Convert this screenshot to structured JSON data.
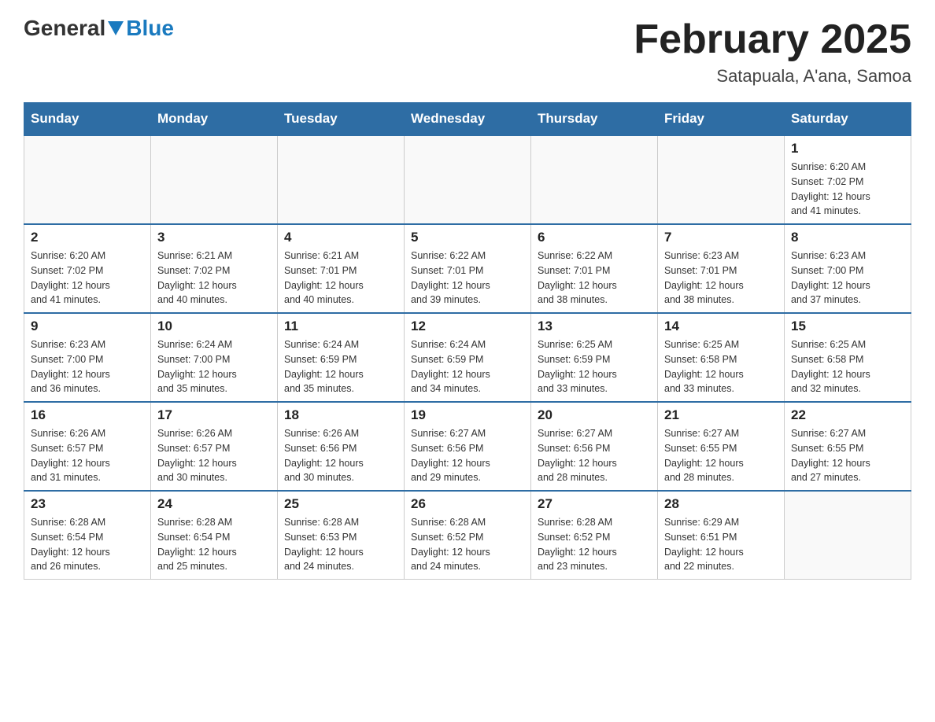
{
  "header": {
    "logo_general": "General",
    "logo_blue": "Blue",
    "month_title": "February 2025",
    "location": "Satapuala, A'ana, Samoa"
  },
  "weekdays": [
    "Sunday",
    "Monday",
    "Tuesday",
    "Wednesday",
    "Thursday",
    "Friday",
    "Saturday"
  ],
  "weeks": [
    [
      {
        "day": "",
        "info": ""
      },
      {
        "day": "",
        "info": ""
      },
      {
        "day": "",
        "info": ""
      },
      {
        "day": "",
        "info": ""
      },
      {
        "day": "",
        "info": ""
      },
      {
        "day": "",
        "info": ""
      },
      {
        "day": "1",
        "info": "Sunrise: 6:20 AM\nSunset: 7:02 PM\nDaylight: 12 hours\nand 41 minutes."
      }
    ],
    [
      {
        "day": "2",
        "info": "Sunrise: 6:20 AM\nSunset: 7:02 PM\nDaylight: 12 hours\nand 41 minutes."
      },
      {
        "day": "3",
        "info": "Sunrise: 6:21 AM\nSunset: 7:02 PM\nDaylight: 12 hours\nand 40 minutes."
      },
      {
        "day": "4",
        "info": "Sunrise: 6:21 AM\nSunset: 7:01 PM\nDaylight: 12 hours\nand 40 minutes."
      },
      {
        "day": "5",
        "info": "Sunrise: 6:22 AM\nSunset: 7:01 PM\nDaylight: 12 hours\nand 39 minutes."
      },
      {
        "day": "6",
        "info": "Sunrise: 6:22 AM\nSunset: 7:01 PM\nDaylight: 12 hours\nand 38 minutes."
      },
      {
        "day": "7",
        "info": "Sunrise: 6:23 AM\nSunset: 7:01 PM\nDaylight: 12 hours\nand 38 minutes."
      },
      {
        "day": "8",
        "info": "Sunrise: 6:23 AM\nSunset: 7:00 PM\nDaylight: 12 hours\nand 37 minutes."
      }
    ],
    [
      {
        "day": "9",
        "info": "Sunrise: 6:23 AM\nSunset: 7:00 PM\nDaylight: 12 hours\nand 36 minutes."
      },
      {
        "day": "10",
        "info": "Sunrise: 6:24 AM\nSunset: 7:00 PM\nDaylight: 12 hours\nand 35 minutes."
      },
      {
        "day": "11",
        "info": "Sunrise: 6:24 AM\nSunset: 6:59 PM\nDaylight: 12 hours\nand 35 minutes."
      },
      {
        "day": "12",
        "info": "Sunrise: 6:24 AM\nSunset: 6:59 PM\nDaylight: 12 hours\nand 34 minutes."
      },
      {
        "day": "13",
        "info": "Sunrise: 6:25 AM\nSunset: 6:59 PM\nDaylight: 12 hours\nand 33 minutes."
      },
      {
        "day": "14",
        "info": "Sunrise: 6:25 AM\nSunset: 6:58 PM\nDaylight: 12 hours\nand 33 minutes."
      },
      {
        "day": "15",
        "info": "Sunrise: 6:25 AM\nSunset: 6:58 PM\nDaylight: 12 hours\nand 32 minutes."
      }
    ],
    [
      {
        "day": "16",
        "info": "Sunrise: 6:26 AM\nSunset: 6:57 PM\nDaylight: 12 hours\nand 31 minutes."
      },
      {
        "day": "17",
        "info": "Sunrise: 6:26 AM\nSunset: 6:57 PM\nDaylight: 12 hours\nand 30 minutes."
      },
      {
        "day": "18",
        "info": "Sunrise: 6:26 AM\nSunset: 6:56 PM\nDaylight: 12 hours\nand 30 minutes."
      },
      {
        "day": "19",
        "info": "Sunrise: 6:27 AM\nSunset: 6:56 PM\nDaylight: 12 hours\nand 29 minutes."
      },
      {
        "day": "20",
        "info": "Sunrise: 6:27 AM\nSunset: 6:56 PM\nDaylight: 12 hours\nand 28 minutes."
      },
      {
        "day": "21",
        "info": "Sunrise: 6:27 AM\nSunset: 6:55 PM\nDaylight: 12 hours\nand 28 minutes."
      },
      {
        "day": "22",
        "info": "Sunrise: 6:27 AM\nSunset: 6:55 PM\nDaylight: 12 hours\nand 27 minutes."
      }
    ],
    [
      {
        "day": "23",
        "info": "Sunrise: 6:28 AM\nSunset: 6:54 PM\nDaylight: 12 hours\nand 26 minutes."
      },
      {
        "day": "24",
        "info": "Sunrise: 6:28 AM\nSunset: 6:54 PM\nDaylight: 12 hours\nand 25 minutes."
      },
      {
        "day": "25",
        "info": "Sunrise: 6:28 AM\nSunset: 6:53 PM\nDaylight: 12 hours\nand 24 minutes."
      },
      {
        "day": "26",
        "info": "Sunrise: 6:28 AM\nSunset: 6:52 PM\nDaylight: 12 hours\nand 24 minutes."
      },
      {
        "day": "27",
        "info": "Sunrise: 6:28 AM\nSunset: 6:52 PM\nDaylight: 12 hours\nand 23 minutes."
      },
      {
        "day": "28",
        "info": "Sunrise: 6:29 AM\nSunset: 6:51 PM\nDaylight: 12 hours\nand 22 minutes."
      },
      {
        "day": "",
        "info": ""
      }
    ]
  ]
}
